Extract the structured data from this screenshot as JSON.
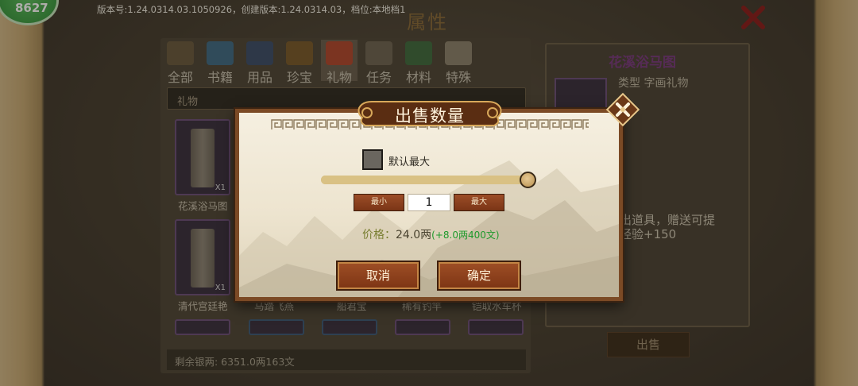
{
  "hud": {
    "avatar_text": "8627",
    "version_text": "版本号:1.24.0314.03.1050926，创建版本:1.24.0314.03，档位:本地档1",
    "page_title": "属性"
  },
  "tabs": [
    {
      "label": "全部",
      "icon": "bag-icon"
    },
    {
      "label": "书籍",
      "icon": "book-icon"
    },
    {
      "label": "用品",
      "icon": "gourd-icon"
    },
    {
      "label": "珍宝",
      "icon": "chest-icon"
    },
    {
      "label": "礼物",
      "icon": "gift-icon",
      "active": true
    },
    {
      "label": "任务",
      "icon": "scroll-icon"
    },
    {
      "label": "材料",
      "icon": "herb-icon"
    },
    {
      "label": "特殊",
      "icon": "pearl-icon"
    }
  ],
  "category_select": {
    "value": "礼物"
  },
  "items": [
    {
      "name": "花溪浴马图",
      "qty": "X1"
    },
    {
      "name": "清代宫廷艳",
      "qty": "X1"
    },
    {
      "name": "马踏飞燕"
    },
    {
      "name": "船君宝"
    },
    {
      "name": "稀有钓竿"
    },
    {
      "name": "铠取水车杯"
    }
  ],
  "money_bar": {
    "text": "剩余银两: 6351.0两163文"
  },
  "detail": {
    "title": "花溪浴马图",
    "type_line": "类型  字画礼物",
    "desc_line1": "出道具，赠送可提",
    "desc_line2": "经验+150",
    "sell_button": "出售"
  },
  "dialog": {
    "title": "出售数量",
    "checkbox_label": "默认最大",
    "min_label": "最小",
    "max_label": "最大",
    "quantity": "1",
    "slider_fraction": 1.0,
    "price_label": "价格：",
    "price_value": "24.0两",
    "price_bonus": "(+8.0两400文)",
    "cancel_label": "取消",
    "confirm_label": "确定"
  },
  "colors": {
    "accent_button": "#8b4320",
    "bonus_green": "#1f9a2c",
    "price_label": "#7a7f32"
  }
}
